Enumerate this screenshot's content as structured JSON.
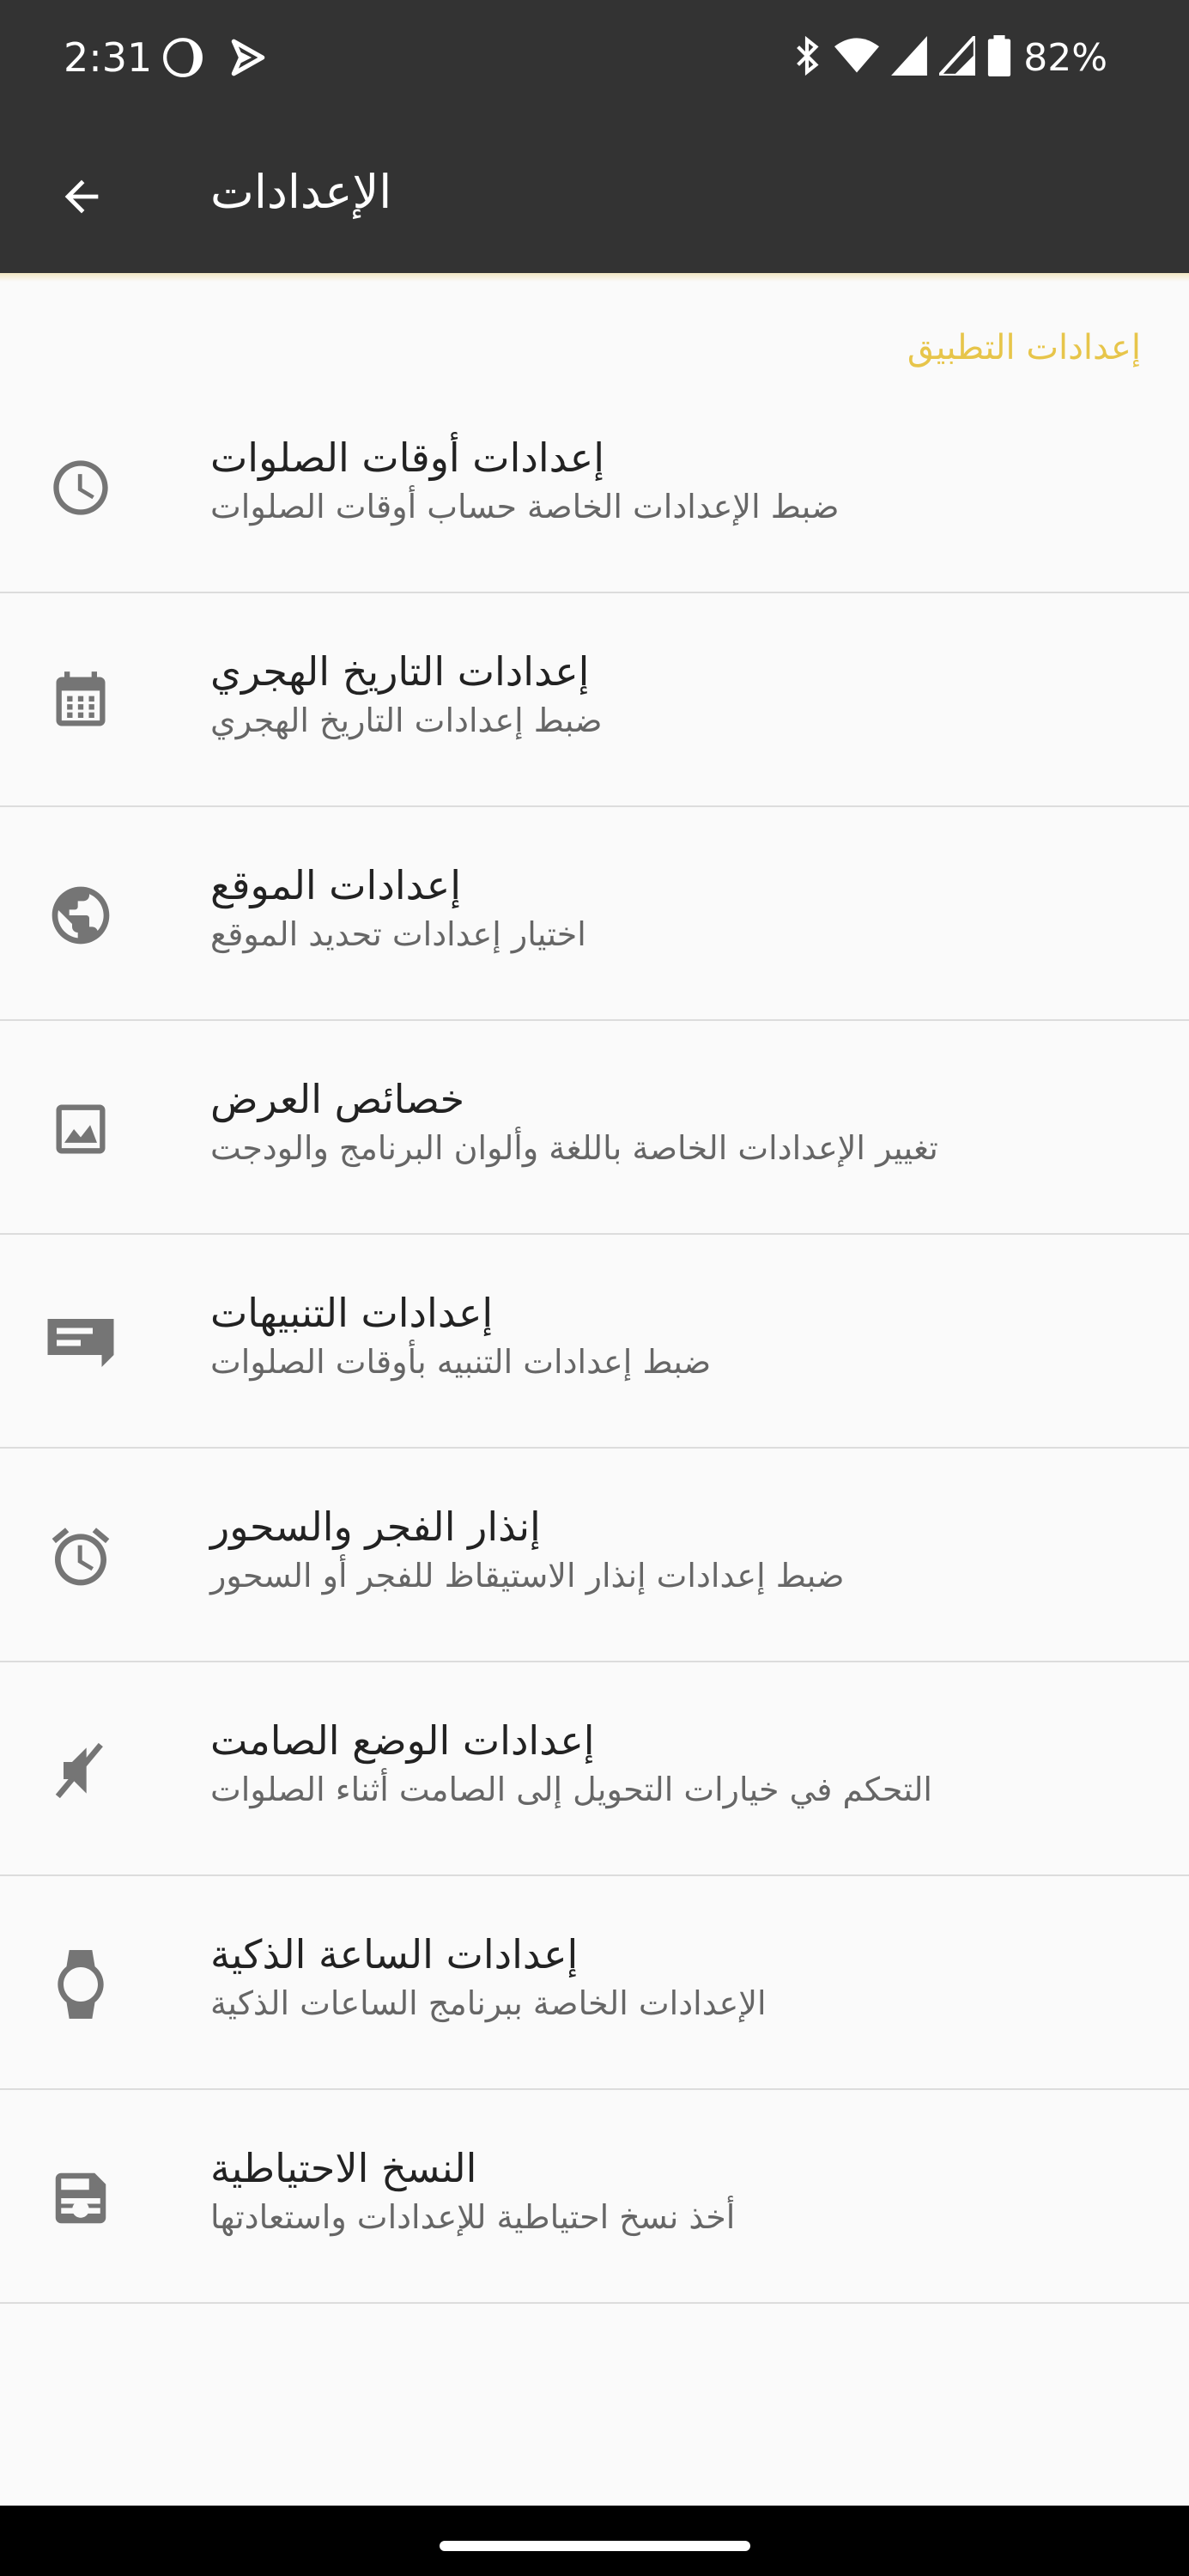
{
  "status_bar": {
    "time": "2:31",
    "battery_percent": "82%",
    "icons": [
      "moon-icon",
      "play-icon",
      "bluetooth-icon",
      "wifi-icon",
      "signal-icon",
      "signal-icon",
      "battery-icon"
    ]
  },
  "app_bar": {
    "title": "الإعدادات",
    "back_icon": "arrow-back-icon"
  },
  "section": {
    "header": "إعدادات التطبيق"
  },
  "items": [
    {
      "title": "إعدادات أوقات الصلوات",
      "subtitle": "ضبط الإعدادات الخاصة حساب أوقات الصلوات",
      "icon": "clock-icon"
    },
    {
      "title": "إعدادات التاريخ الهجري",
      "subtitle": "ضبط إعدادات التاريخ الهجري",
      "icon": "calendar-icon"
    },
    {
      "title": "إعدادات الموقع",
      "subtitle": "اختيار إعدادات تحديد الموقع",
      "icon": "globe-icon"
    },
    {
      "title": "خصائص العرض",
      "subtitle": "تغيير الإعدادات الخاصة باللغة وألوان البرنامج والودجت",
      "icon": "image-icon"
    },
    {
      "title": "إعدادات التنبيهات",
      "subtitle": "ضبط إعدادات التنبيه بأوقات الصلوات",
      "icon": "message-icon"
    },
    {
      "title": "إنذار الفجر والسحور",
      "subtitle": "ضبط إعدادات إنذار الاستيقاظ للفجر أو السحور",
      "icon": "alarm-icon"
    },
    {
      "title": "إعدادات الوضع الصامت",
      "subtitle": "التحكم في خيارات التحويل إلى الصامت أثناء الصلوات",
      "icon": "volume-off-icon"
    },
    {
      "title": "إعدادات الساعة الذكية",
      "subtitle": "الإعدادات الخاصة ببرنامج الساعات الذكية",
      "icon": "watch-icon"
    },
    {
      "title": "النسخ الاحتياطية",
      "subtitle": "أخذ نسخ احتياطية للإعدادات واستعادتها",
      "icon": "save-icon"
    }
  ],
  "colors": {
    "app_bar": "#333333",
    "accent": "#e7c54a",
    "background": "#fafafa",
    "icon": "#757575"
  }
}
